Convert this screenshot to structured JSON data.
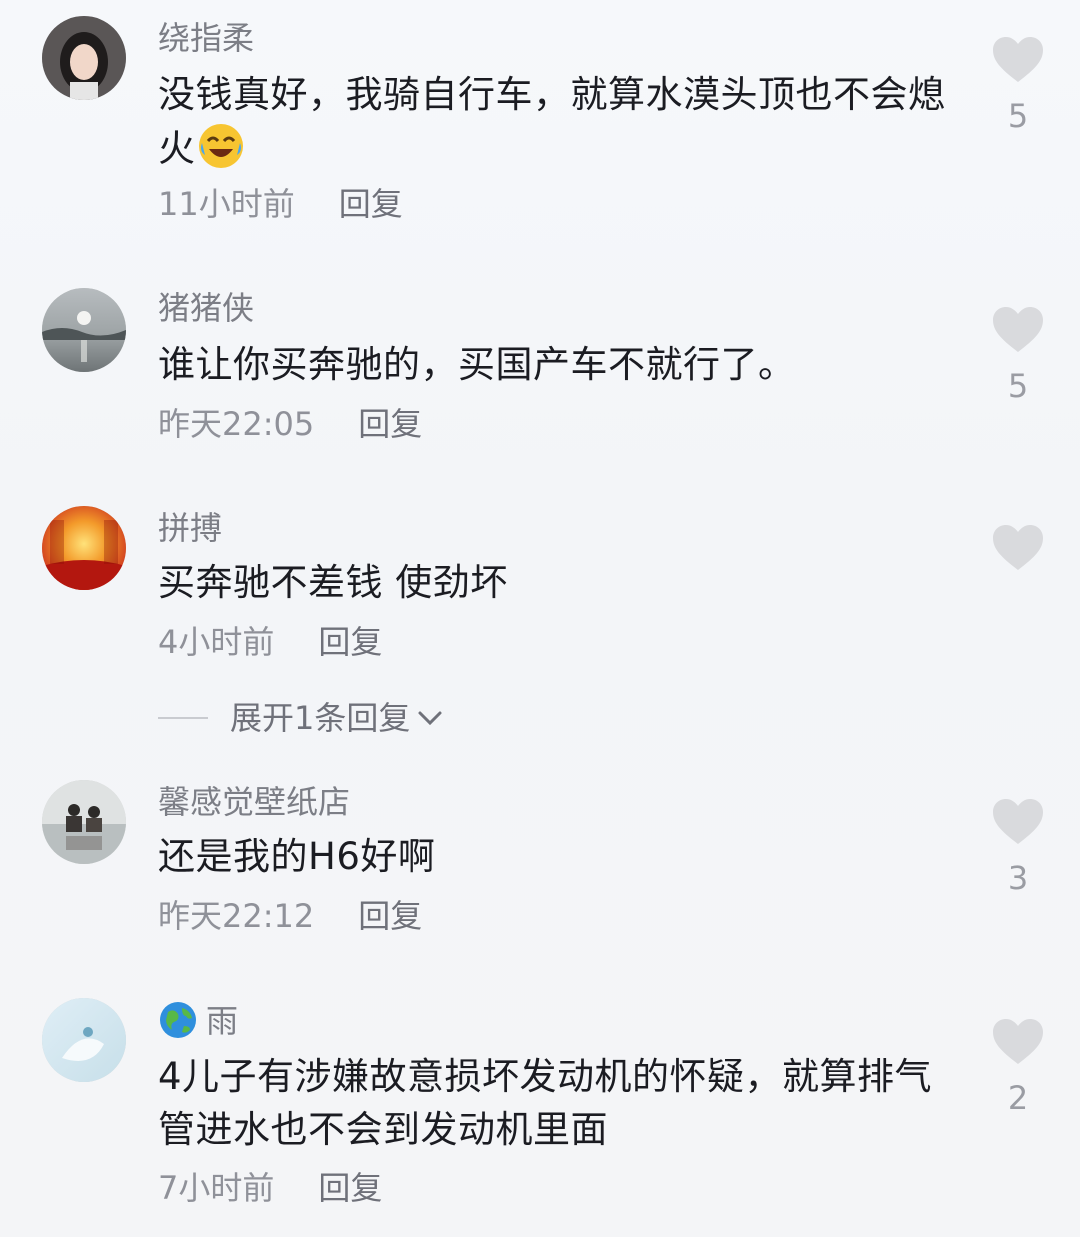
{
  "comments": [
    {
      "username": "绕指柔",
      "text": "没钱真好，我骑自行车，就算水漠头顶也不会熄火",
      "time": "11小时前",
      "reply": "回复",
      "likes": "5"
    },
    {
      "username": "猪猪侠",
      "text": "谁让你买奔驰的，买国产车不就行了。",
      "time": "昨天22:05",
      "reply": "回复",
      "likes": "5"
    },
    {
      "username": "拼搏",
      "text": "买奔驰不差钱 使劲坏",
      "time": "4小时前",
      "reply": "回复",
      "likes": ""
    },
    {
      "username": "馨感觉壁纸店",
      "text": "还是我的H6好啊",
      "time": "昨天22:12",
      "reply": "回复",
      "likes": "3"
    },
    {
      "username": "雨",
      "text": "4儿子有涉嫌故意损坏发动机的怀疑，就算排气管进水也不会到发动机里面",
      "time": "7小时前",
      "reply": "回复",
      "likes": "2"
    }
  ],
  "expand_replies": "展开1条回复",
  "colors": {
    "username": "#7c7e86",
    "text": "#1b1c22",
    "meta": "#8f9199",
    "heart": "#d9dadd"
  },
  "icons": [
    "heart-icon",
    "chevron-down-icon",
    "laughing-emoji-icon",
    "globe-icon"
  ]
}
